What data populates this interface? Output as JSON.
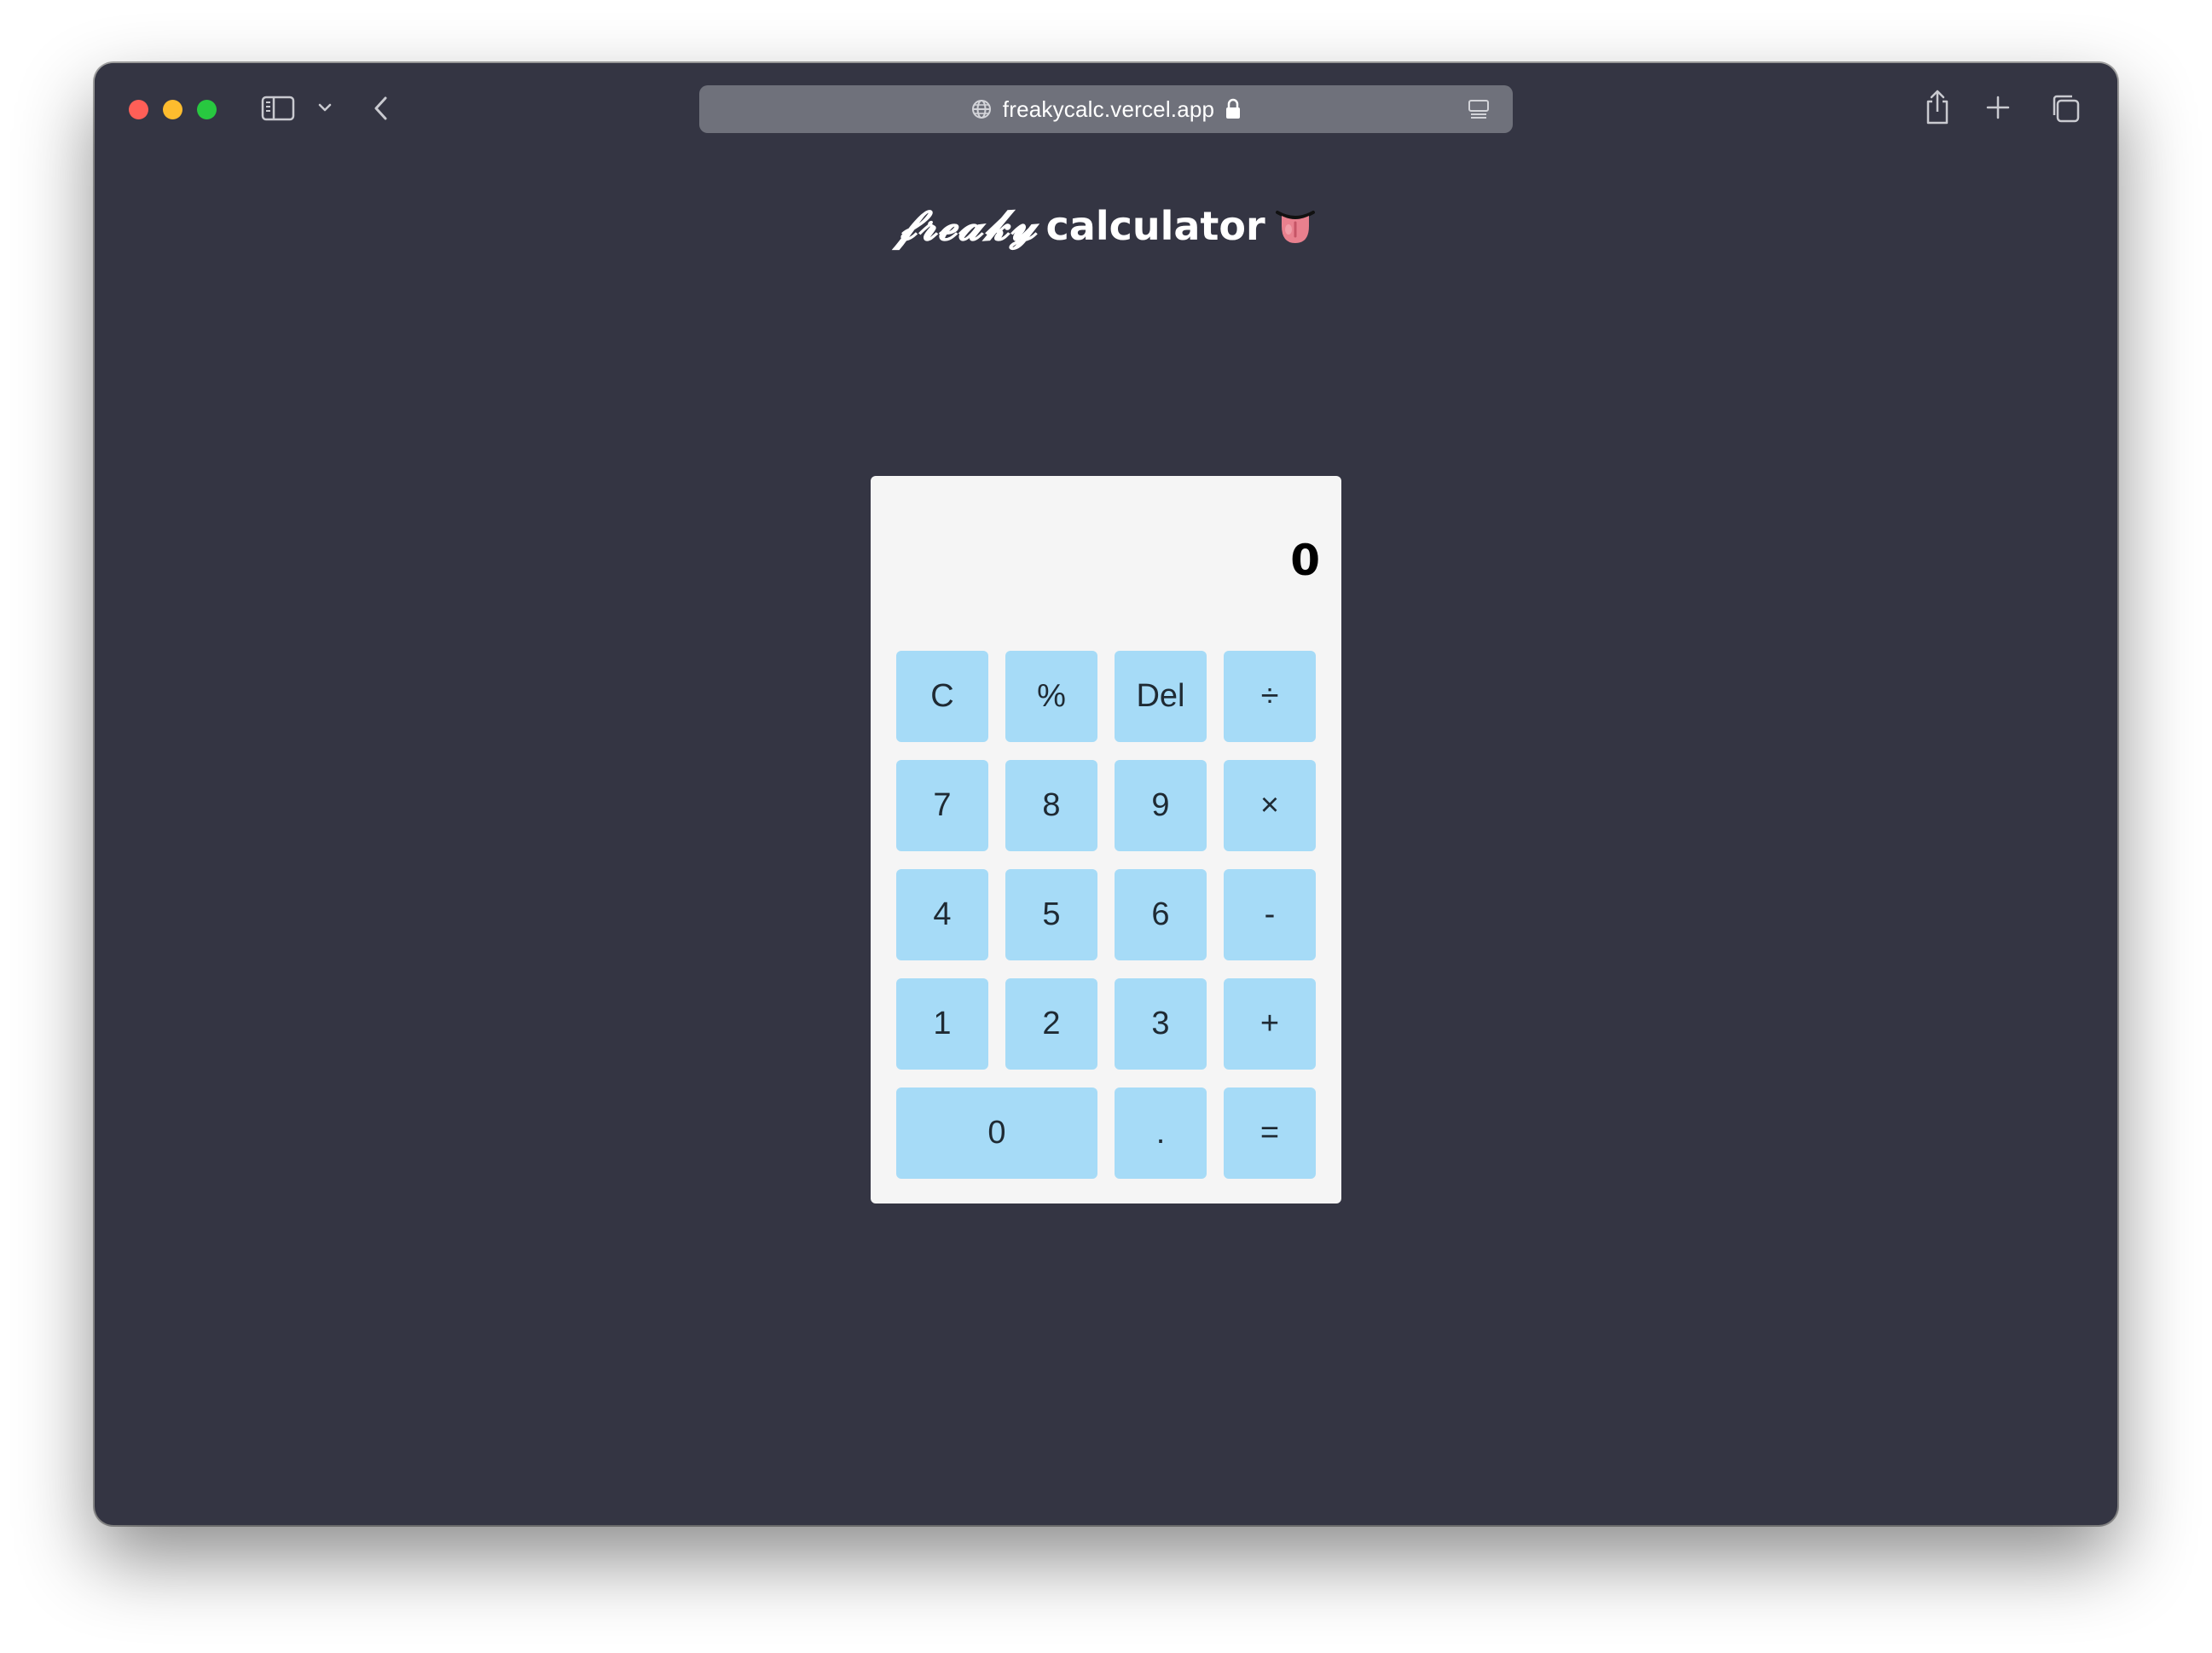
{
  "browser": {
    "url": "freakycalc.vercel.app",
    "colors": {
      "window_bg": "#343543",
      "address_bar_bg": "#6f717b",
      "close": "#ff5f57",
      "minimize": "#febc2e",
      "maximize": "#28c840"
    },
    "icons": [
      "sidebar-icon",
      "chevron-down-icon",
      "back-icon",
      "globe-icon",
      "lock-icon",
      "reader-icon",
      "share-icon",
      "new-tab-icon",
      "tab-overview-icon"
    ]
  },
  "page": {
    "title_freaky": "𝓯𝓻𝓮𝓪𝓴𝔂",
    "title_calc": "calculator",
    "title_emoji": "tongue-emoji"
  },
  "calculator": {
    "display": "0",
    "colors": {
      "panel_bg": "#f5f5f5",
      "button_bg": "#a6dbf7",
      "button_text": "#1f2a33"
    },
    "buttons": {
      "clear": "C",
      "percent": "%",
      "delete": "Del",
      "divide": "÷",
      "seven": "7",
      "eight": "8",
      "nine": "9",
      "multiply": "×",
      "four": "4",
      "five": "5",
      "six": "6",
      "subtract": "-",
      "one": "1",
      "two": "2",
      "three": "3",
      "add": "+",
      "zero": "0",
      "decimal": ".",
      "equals": "="
    }
  }
}
